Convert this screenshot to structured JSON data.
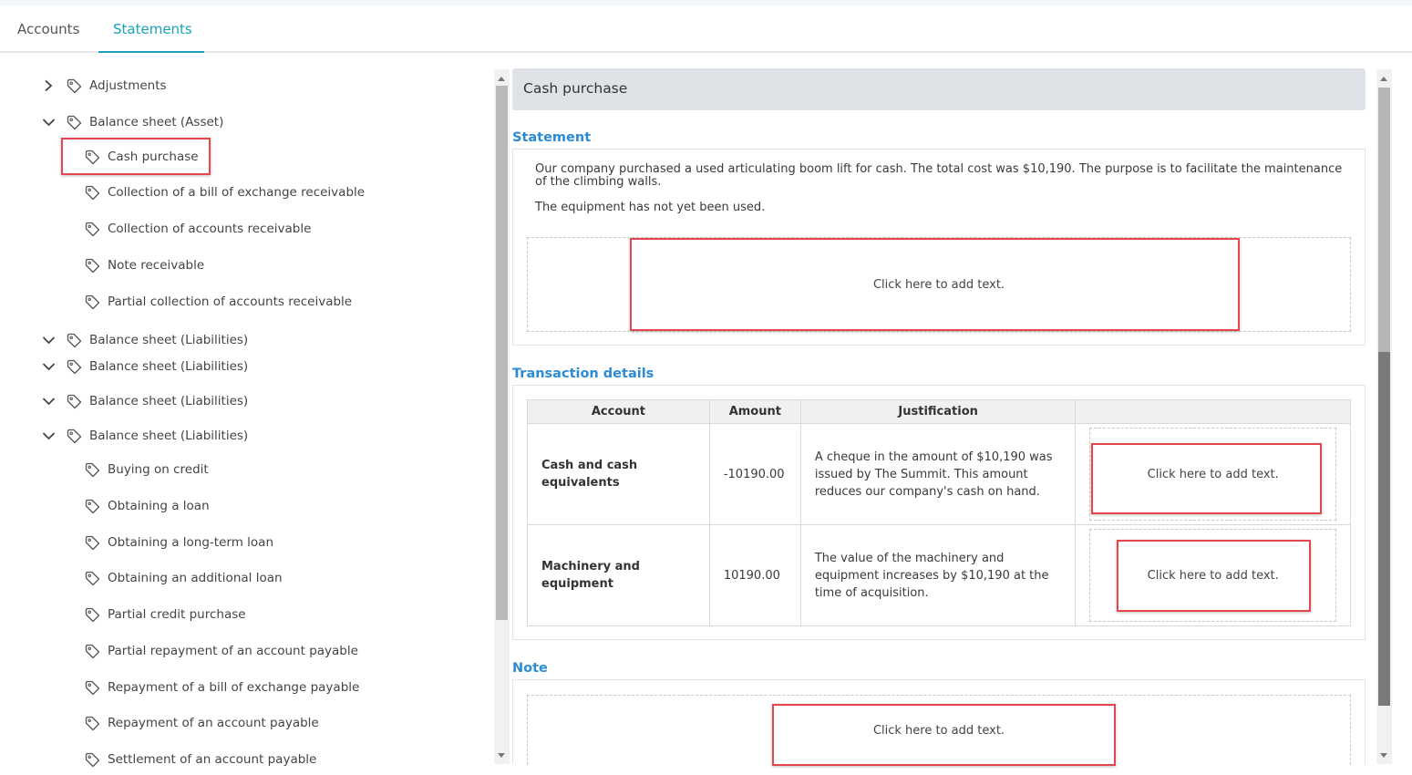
{
  "tabs": [
    {
      "label": "Accounts",
      "active": false
    },
    {
      "label": "Statements",
      "active": true
    }
  ],
  "accent_color": "#17a2b8",
  "highlight_color": "#e5464d",
  "tree": {
    "items": [
      {
        "label": "Adjustments",
        "chevron": "right"
      },
      {
        "label": "Balance sheet (Asset)",
        "chevron": "down"
      },
      {
        "label": "Cash purchase",
        "chevron": null,
        "selected": true
      },
      {
        "label": "Collection of a bill of exchange receivable",
        "chevron": null
      },
      {
        "label": "Collection of accounts receivable",
        "chevron": null
      },
      {
        "label": "Note receivable",
        "chevron": null
      },
      {
        "label": "Partial collection of accounts receivable",
        "chevron": null
      },
      {
        "label": "Balance sheet (Liabilities)",
        "chevron": "down"
      },
      {
        "label": "Balance sheet (Liabilities)",
        "chevron": "down"
      },
      {
        "label": "Balance sheet (Liabilities)",
        "chevron": "down"
      },
      {
        "label": "Balance sheet (Liabilities)",
        "chevron": "down"
      },
      {
        "label": "Buying on credit",
        "chevron": null
      },
      {
        "label": "Obtaining a loan",
        "chevron": null
      },
      {
        "label": "Obtaining a long-term loan",
        "chevron": null
      },
      {
        "label": "Obtaining an additional loan",
        "chevron": null
      },
      {
        "label": "Partial credit purchase",
        "chevron": null
      },
      {
        "label": "Partial repayment of an account payable",
        "chevron": null
      },
      {
        "label": "Repayment of a bill of exchange payable",
        "chevron": null
      },
      {
        "label": "Repayment of an account payable",
        "chevron": null
      },
      {
        "label": "Settlement of an account payable",
        "chevron": null
      }
    ]
  },
  "detail": {
    "title": "Cash purchase",
    "statement": {
      "heading": "Statement",
      "paragraph1": "Our company purchased a used articulating boom lift for cash. The total cost was $10,190. The purpose is to facilitate the maintenance of the climbing walls.",
      "paragraph2": "The equipment has not yet been used.",
      "placeholder": "Click here to add text."
    },
    "transactions": {
      "heading": "Transaction details",
      "columns": [
        "Account",
        "Amount",
        "Justification",
        ""
      ],
      "rows": [
        {
          "account": "Cash and cash equivalents",
          "amount": "-10190.00",
          "justification": "A cheque in the amount of $10,190 was issued by The Summit. This amount reduces our company's cash on hand.",
          "placeholder": "Click here to add text."
        },
        {
          "account": "Machinery and equipment",
          "amount": "10190.00",
          "justification": "The value of the machinery and equipment increases by $10,190 at the time of acquisition.",
          "placeholder": "Click here to add text."
        }
      ]
    },
    "note": {
      "heading": "Note",
      "placeholder": "Click here to add text."
    }
  }
}
